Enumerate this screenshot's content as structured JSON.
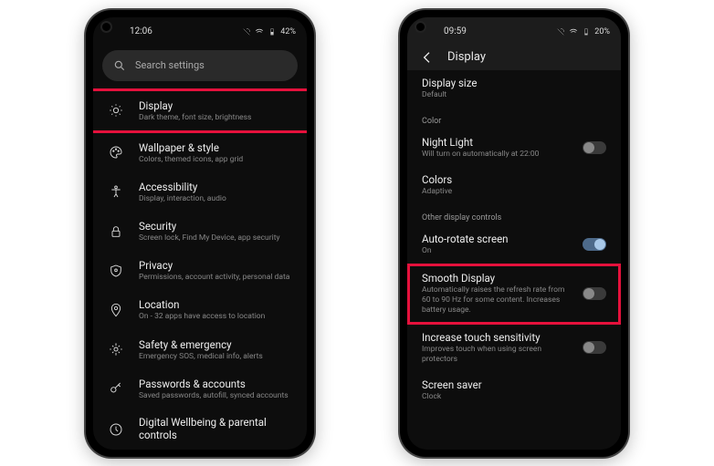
{
  "phone1": {
    "time": "12:06",
    "battery": "42%",
    "search_placeholder": "Search settings",
    "items": [
      {
        "title": "Display",
        "sub": "Dark theme, font size, brightness"
      },
      {
        "title": "Wallpaper & style",
        "sub": "Colors, themed icons, app grid"
      },
      {
        "title": "Accessibility",
        "sub": "Display, interaction, audio"
      },
      {
        "title": "Security",
        "sub": "Screen lock, Find My Device, app security"
      },
      {
        "title": "Privacy",
        "sub": "Permissions, account activity, personal data"
      },
      {
        "title": "Location",
        "sub": "On - 32 apps have access to location"
      },
      {
        "title": "Safety & emergency",
        "sub": "Emergency SOS, medical info, alerts"
      },
      {
        "title": "Passwords & accounts",
        "sub": "Saved passwords, autofill, synced accounts"
      },
      {
        "title": "Digital Wellbeing & parental controls",
        "sub": ""
      }
    ]
  },
  "phone2": {
    "time": "09:59",
    "battery": "20%",
    "page_title": "Display",
    "top": {
      "title": "Display size",
      "sub": "Default"
    },
    "section_color": "Color",
    "night": {
      "title": "Night Light",
      "sub": "Will turn on automatically at 22:00"
    },
    "colors": {
      "title": "Colors",
      "sub": "Adaptive"
    },
    "section_other": "Other display controls",
    "autorotate": {
      "title": "Auto-rotate screen",
      "sub": "On"
    },
    "smooth": {
      "title": "Smooth Display",
      "sub": "Automatically raises the refresh rate from 60 to 90 Hz for some content. Increases battery usage."
    },
    "touch": {
      "title": "Increase touch sensitivity",
      "sub": "Improves touch when using screen protectors"
    },
    "saver": {
      "title": "Screen saver",
      "sub": "Clock"
    }
  }
}
